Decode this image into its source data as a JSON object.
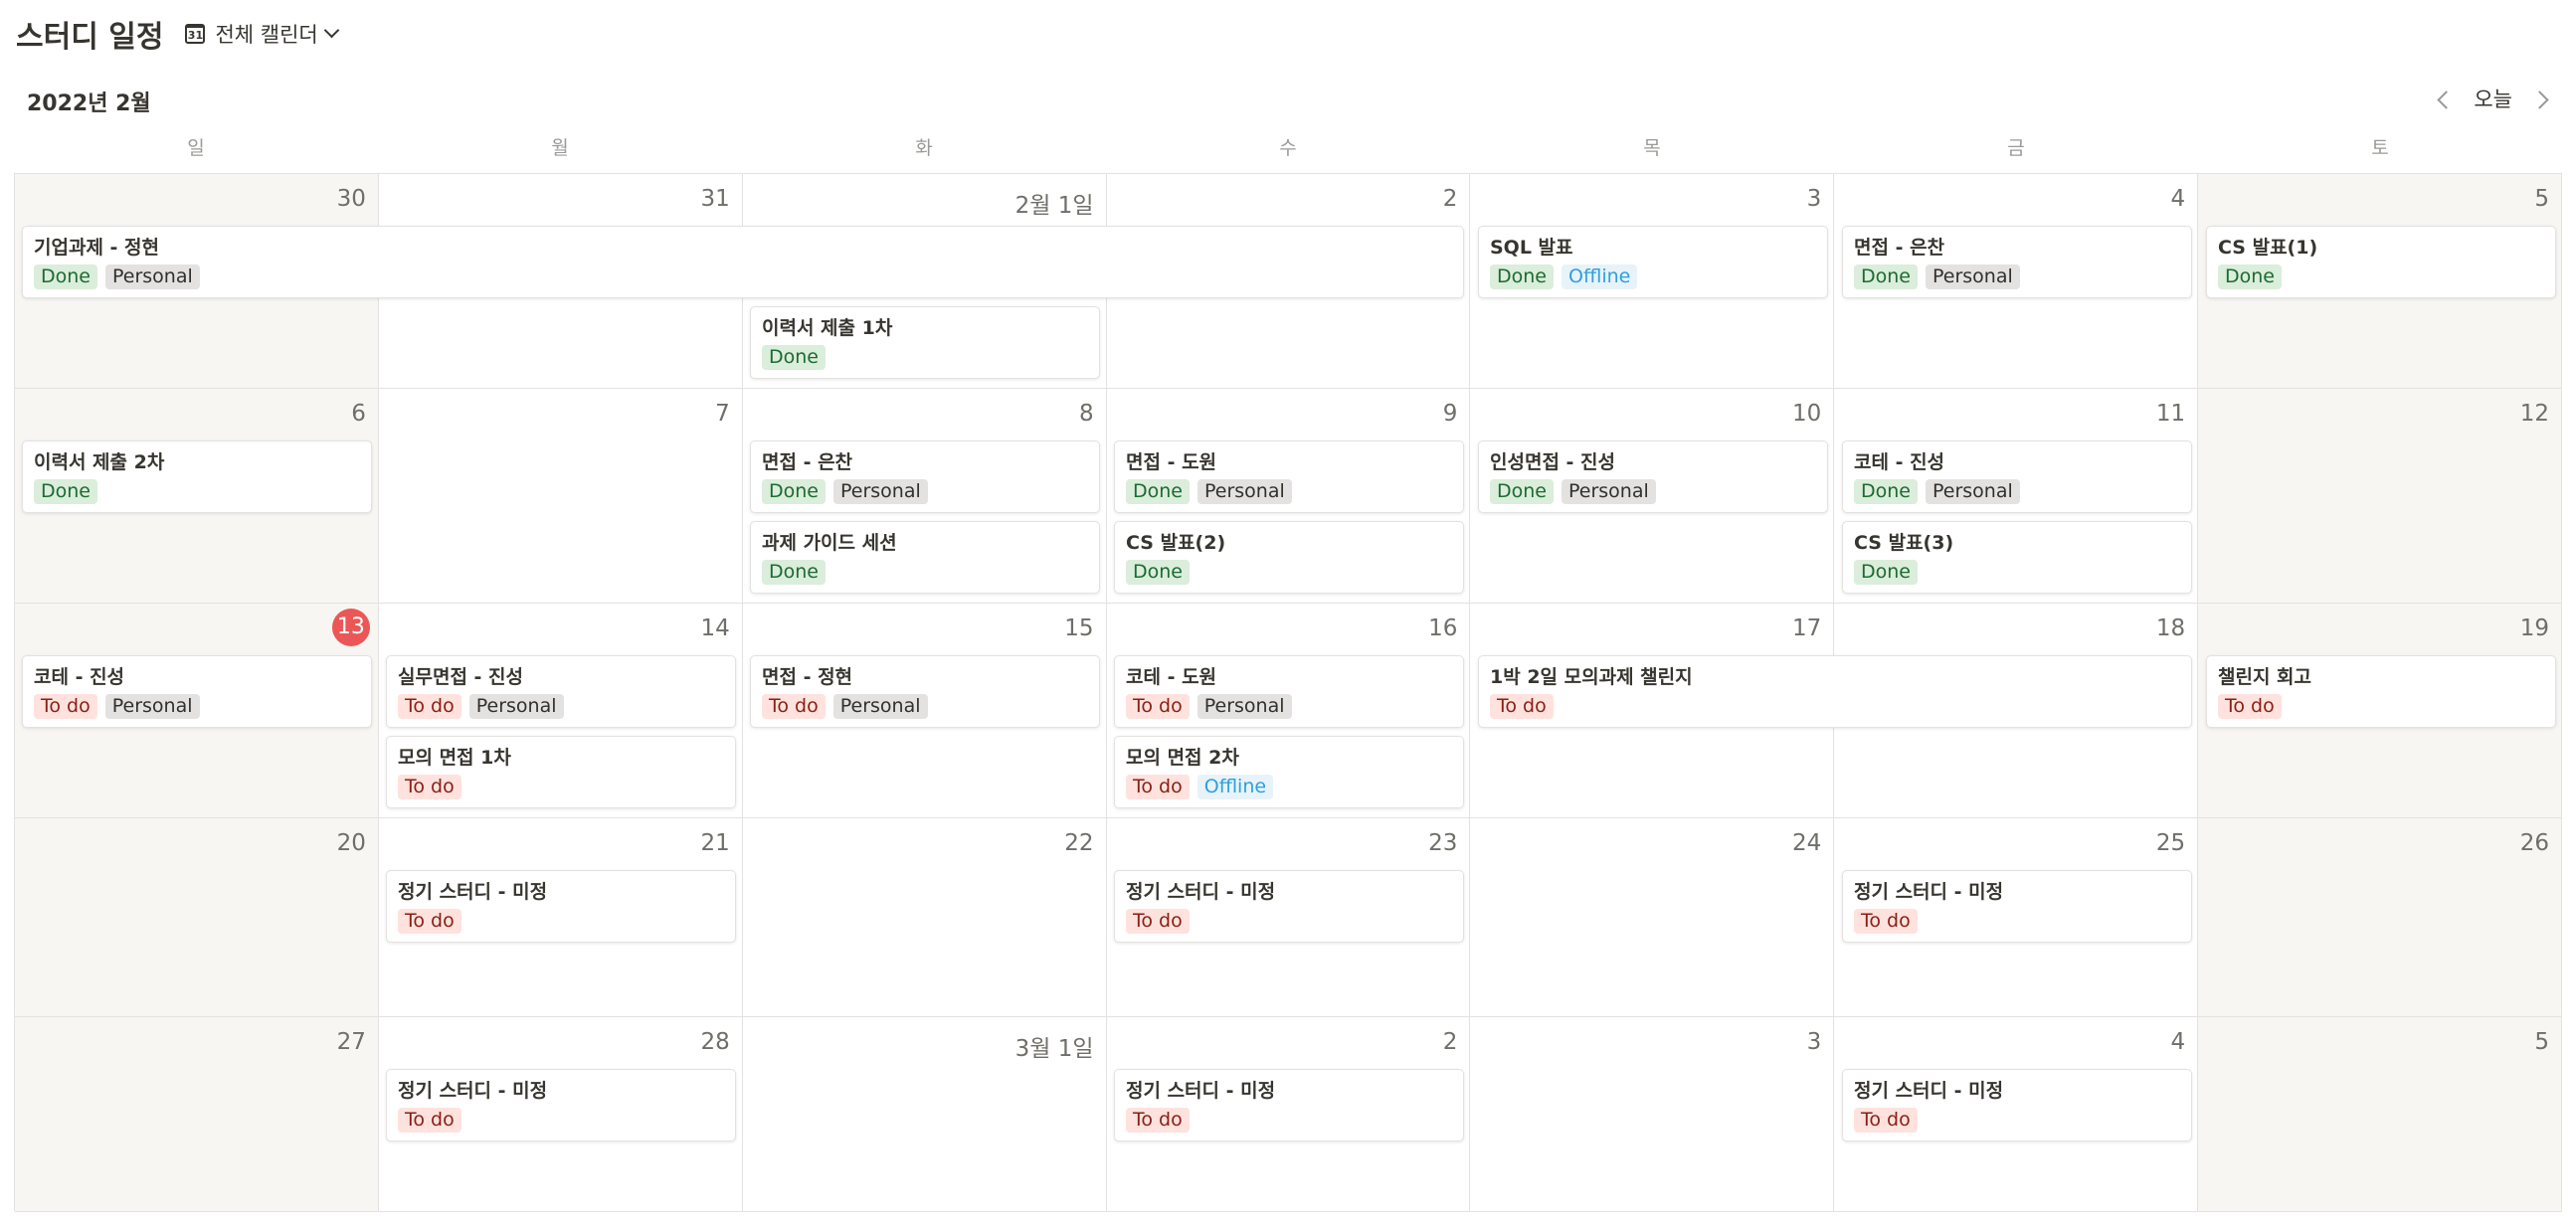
{
  "header": {
    "title": "스터디 일정",
    "view_icon_text": "31",
    "view_label": "전체 캘린더",
    "view_icon": "calendar-icon"
  },
  "nav": {
    "month": "2022년 2월",
    "today": "오늘",
    "prev_icon": "chevron-left-icon",
    "next_icon": "chevron-right-icon"
  },
  "weekdays": [
    "일",
    "월",
    "화",
    "수",
    "목",
    "금",
    "토"
  ],
  "weeks": [
    {
      "days": [
        "30",
        "31",
        "2월 1일",
        "2",
        "3",
        "4",
        "5"
      ]
    },
    {
      "days": [
        "6",
        "7",
        "8",
        "9",
        "10",
        "11",
        "12"
      ]
    },
    {
      "days": [
        "13",
        "14",
        "15",
        "16",
        "17",
        "18",
        "19"
      ]
    },
    {
      "days": [
        "20",
        "21",
        "22",
        "23",
        "24",
        "25",
        "26"
      ]
    },
    {
      "days": [
        "27",
        "28",
        "3월 1일",
        "2",
        "3",
        "4",
        "5"
      ]
    }
  ],
  "today_label": "13",
  "events": [
    {
      "week": 0,
      "start": 0,
      "span": 4,
      "slot": 0,
      "title": "기업과제 - 정현",
      "tags": [
        "Done",
        "Personal"
      ]
    },
    {
      "week": 0,
      "start": 4,
      "span": 1,
      "slot": 0,
      "title": "SQL 발표",
      "tags": [
        "Done",
        "Offline"
      ]
    },
    {
      "week": 0,
      "start": 5,
      "span": 1,
      "slot": 0,
      "title": "면접 - 은찬",
      "tags": [
        "Done",
        "Personal"
      ]
    },
    {
      "week": 0,
      "start": 6,
      "span": 1,
      "slot": 0,
      "title": "CS 발표(1)",
      "tags": [
        "Done"
      ]
    },
    {
      "week": 0,
      "start": 2,
      "span": 1,
      "slot": 1,
      "title": "이력서 제출 1차",
      "tags": [
        "Done"
      ]
    },
    {
      "week": 1,
      "start": 0,
      "span": 1,
      "slot": 0,
      "title": "이력서 제출 2차",
      "tags": [
        "Done"
      ]
    },
    {
      "week": 1,
      "start": 2,
      "span": 1,
      "slot": 0,
      "title": "면접 - 은찬",
      "tags": [
        "Done",
        "Personal"
      ]
    },
    {
      "week": 1,
      "start": 2,
      "span": 1,
      "slot": 1,
      "title": "과제 가이드 세션",
      "tags": [
        "Done"
      ]
    },
    {
      "week": 1,
      "start": 3,
      "span": 1,
      "slot": 0,
      "title": "면접 - 도원",
      "tags": [
        "Done",
        "Personal"
      ]
    },
    {
      "week": 1,
      "start": 3,
      "span": 1,
      "slot": 1,
      "title": "CS 발표(2)",
      "tags": [
        "Done"
      ]
    },
    {
      "week": 1,
      "start": 4,
      "span": 1,
      "slot": 0,
      "title": "인성면접 - 진성",
      "tags": [
        "Done",
        "Personal"
      ]
    },
    {
      "week": 1,
      "start": 5,
      "span": 1,
      "slot": 0,
      "title": "코테 - 진성",
      "tags": [
        "Done",
        "Personal"
      ]
    },
    {
      "week": 1,
      "start": 5,
      "span": 1,
      "slot": 1,
      "title": "CS 발표(3)",
      "tags": [
        "Done"
      ]
    },
    {
      "week": 2,
      "start": 0,
      "span": 1,
      "slot": 0,
      "title": "코테 - 진성",
      "tags": [
        "To do",
        "Personal"
      ]
    },
    {
      "week": 2,
      "start": 1,
      "span": 1,
      "slot": 0,
      "title": "실무면접 - 진성",
      "tags": [
        "To do",
        "Personal"
      ]
    },
    {
      "week": 2,
      "start": 1,
      "span": 1,
      "slot": 1,
      "title": "모의 면접 1차",
      "tags": [
        "To do"
      ]
    },
    {
      "week": 2,
      "start": 2,
      "span": 1,
      "slot": 0,
      "title": "면접 - 정현",
      "tags": [
        "To do",
        "Personal"
      ]
    },
    {
      "week": 2,
      "start": 3,
      "span": 1,
      "slot": 0,
      "title": "코테 - 도원",
      "tags": [
        "To do",
        "Personal"
      ]
    },
    {
      "week": 2,
      "start": 3,
      "span": 1,
      "slot": 1,
      "title": "모의 면접 2차",
      "tags": [
        "To do",
        "Offline"
      ]
    },
    {
      "week": 2,
      "start": 4,
      "span": 2,
      "slot": 0,
      "title": "1박 2일 모의과제 챌린지",
      "tags": [
        "To do"
      ]
    },
    {
      "week": 2,
      "start": 6,
      "span": 1,
      "slot": 0,
      "title": "챌린지 회고",
      "tags": [
        "To do"
      ]
    },
    {
      "week": 3,
      "start": 1,
      "span": 1,
      "slot": 0,
      "title": "정기 스터디 - 미정",
      "tags": [
        "To do"
      ]
    },
    {
      "week": 3,
      "start": 3,
      "span": 1,
      "slot": 0,
      "title": "정기 스터디 - 미정",
      "tags": [
        "To do"
      ]
    },
    {
      "week": 3,
      "start": 5,
      "span": 1,
      "slot": 0,
      "title": "정기 스터디 - 미정",
      "tags": [
        "To do"
      ]
    },
    {
      "week": 4,
      "start": 1,
      "span": 1,
      "slot": 0,
      "title": "정기 스터디 - 미정",
      "tags": [
        "To do"
      ]
    },
    {
      "week": 4,
      "start": 3,
      "span": 1,
      "slot": 0,
      "title": "정기 스터디 - 미정",
      "tags": [
        "To do"
      ]
    },
    {
      "week": 4,
      "start": 5,
      "span": 1,
      "slot": 0,
      "title": "정기 스터디 - 미정",
      "tags": [
        "To do"
      ]
    }
  ],
  "tag_colors": {
    "Done": "#dbeddb",
    "To do": "#ffe2dd",
    "Personal": "#e3e2e0",
    "Offline": "#e7f3f8"
  },
  "today_color": "#eb5757"
}
